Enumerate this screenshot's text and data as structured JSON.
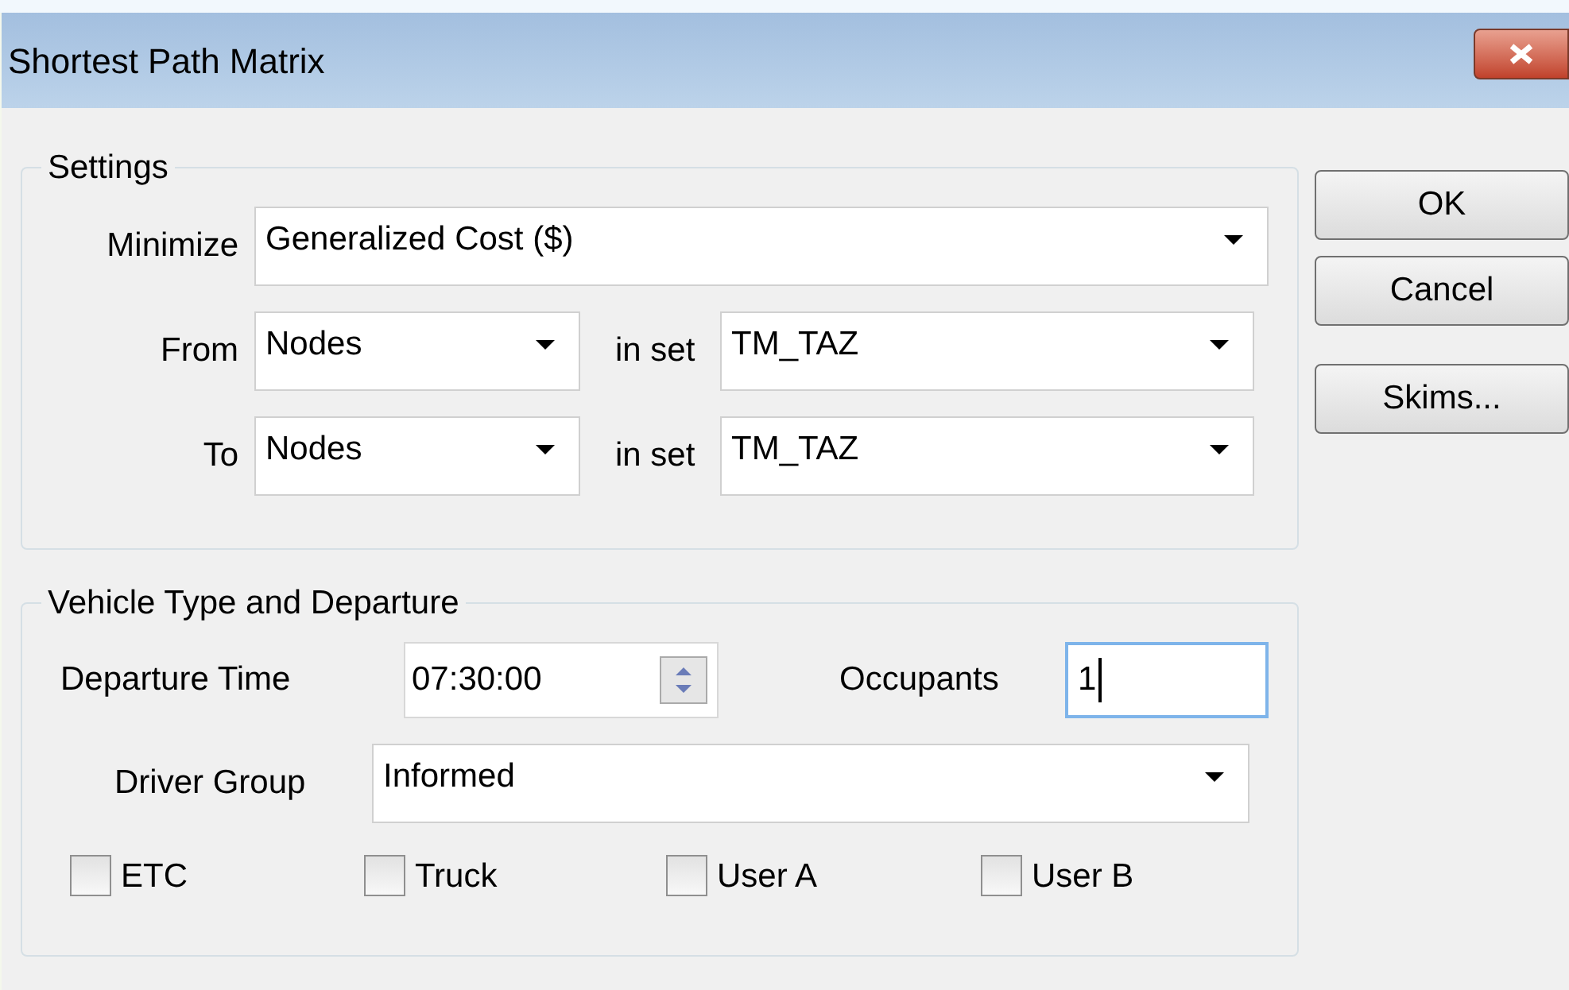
{
  "window": {
    "title": "Shortest Path Matrix"
  },
  "settings": {
    "title": "Settings",
    "minimize": {
      "label": "Minimize",
      "value": "Generalized Cost ($)"
    },
    "from": {
      "label": "From",
      "value": "Nodes",
      "set_label": "in set",
      "set_value": "TM_TAZ"
    },
    "to": {
      "label": "To",
      "value": "Nodes",
      "set_label": "in set",
      "set_value": "TM_TAZ"
    }
  },
  "vehicle": {
    "title": "Vehicle Type and Departure",
    "departure_time": {
      "label": "Departure Time",
      "value": "07:30:00"
    },
    "occupants": {
      "label": "Occupants",
      "value": "1",
      "focused": true
    },
    "driver_group": {
      "label": "Driver Group",
      "value": "Informed"
    },
    "options": [
      {
        "label": "ETC",
        "checked": false
      },
      {
        "label": "Truck",
        "checked": false
      },
      {
        "label": "User A",
        "checked": false
      },
      {
        "label": "User B",
        "checked": false
      }
    ]
  },
  "buttons": [
    {
      "label": "OK"
    },
    {
      "label": "Cancel"
    },
    {
      "label": "Skims..."
    }
  ]
}
